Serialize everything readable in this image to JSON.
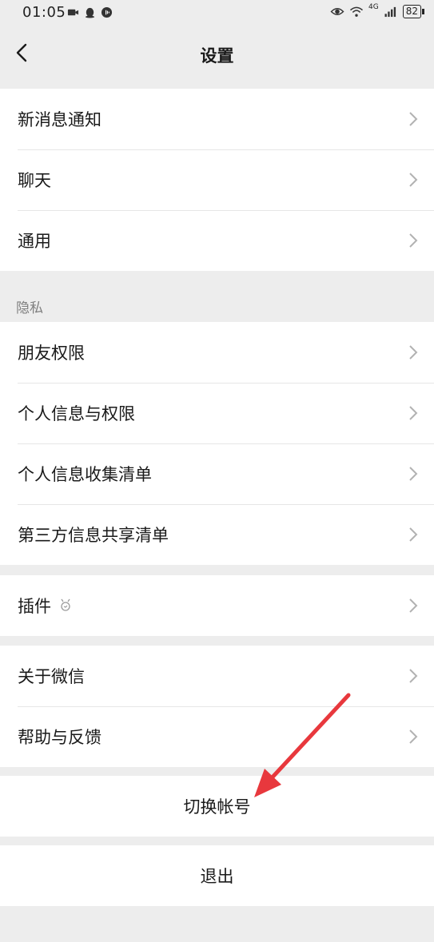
{
  "status_bar": {
    "time": "01:05",
    "network_label": "4G",
    "battery": "82"
  },
  "nav": {
    "title": "设置"
  },
  "group1": {
    "items": [
      {
        "label": "新消息通知"
      },
      {
        "label": "聊天"
      },
      {
        "label": "通用"
      }
    ]
  },
  "privacy": {
    "header": "隐私",
    "items": [
      {
        "label": "朋友权限"
      },
      {
        "label": "个人信息与权限"
      },
      {
        "label": "个人信息收集清单"
      },
      {
        "label": "第三方信息共享清单"
      }
    ]
  },
  "plugins": {
    "label": "插件"
  },
  "group_about": {
    "items": [
      {
        "label": "关于微信"
      },
      {
        "label": "帮助与反馈"
      }
    ]
  },
  "actions": {
    "switch_account": "切换帐号",
    "logout": "退出"
  },
  "colors": {
    "background": "#ededed",
    "card": "#ffffff",
    "annotation_arrow": "#e8383d"
  }
}
